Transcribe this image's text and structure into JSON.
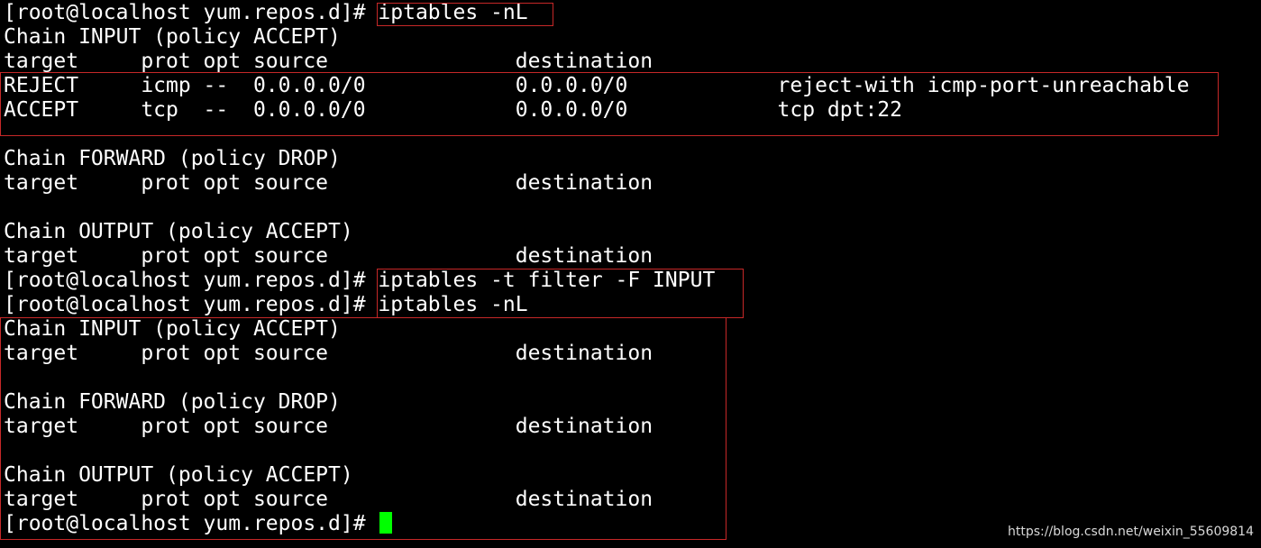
{
  "terminal": {
    "lines": [
      "[root@localhost yum.repos.d]# iptables -nL",
      "Chain INPUT (policy ACCEPT)",
      "target     prot opt source               destination",
      "REJECT     icmp --  0.0.0.0/0            0.0.0.0/0            reject-with icmp-port-unreachable",
      "ACCEPT     tcp  --  0.0.0.0/0            0.0.0.0/0            tcp dpt:22",
      "",
      "Chain FORWARD (policy DROP)",
      "target     prot opt source               destination",
      "",
      "Chain OUTPUT (policy ACCEPT)",
      "target     prot opt source               destination",
      "[root@localhost yum.repos.d]# iptables -t filter -F INPUT",
      "[root@localhost yum.repos.d]# iptables -nL",
      "Chain INPUT (policy ACCEPT)",
      "target     prot opt source               destination",
      "",
      "Chain FORWARD (policy DROP)",
      "target     prot opt source               destination",
      "",
      "Chain OUTPUT (policy ACCEPT)",
      "target     prot opt source               destination",
      "[root@localhost yum.repos.d]# "
    ]
  },
  "colors": {
    "background": "#000000",
    "text": "#ffffff",
    "cursor": "#00ff00",
    "highlight_box": "#c62828"
  },
  "watermark": "https://blog.csdn.net/weixin_55609814"
}
